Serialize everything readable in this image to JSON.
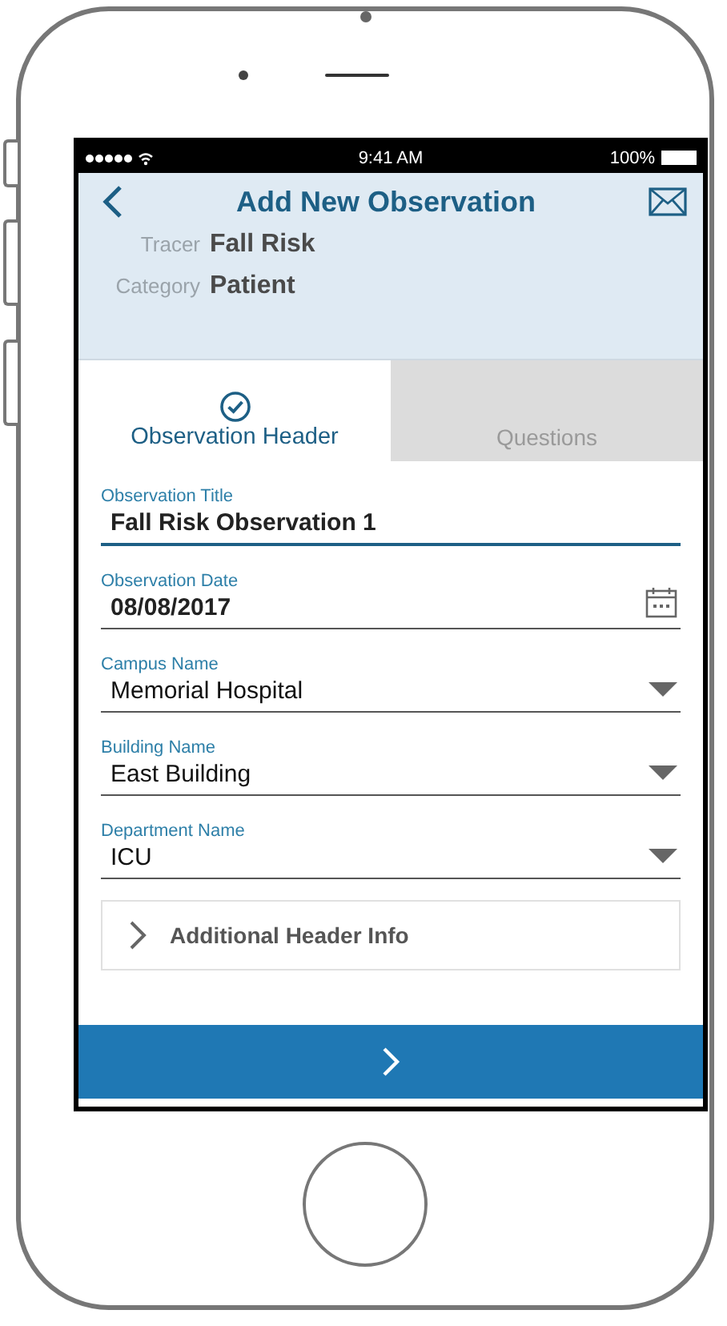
{
  "status_bar": {
    "time": "9:41 AM",
    "battery": "100%"
  },
  "header": {
    "title": "Add New Observation",
    "info": [
      {
        "label": "Tracer",
        "value": "Fall Risk"
      },
      {
        "label": "Category",
        "value": "Patient"
      }
    ]
  },
  "tabs": [
    {
      "label": "Observation Header",
      "selected": true,
      "completed": true
    },
    {
      "label": "Questions",
      "selected": false,
      "completed": false
    }
  ],
  "fields": [
    {
      "kind": "text",
      "label": "Observation Title",
      "value": "Fall Risk Observation 1",
      "focused": true
    },
    {
      "kind": "date",
      "label": "Observation Date",
      "value": "08/08/2017",
      "focused": false
    },
    {
      "kind": "dropdown",
      "label": "Campus Name",
      "value": "Memorial Hospital",
      "focused": false
    },
    {
      "kind": "dropdown",
      "label": "Building Name",
      "value": "East Building",
      "focused": false
    },
    {
      "kind": "dropdown",
      "label": "Department Name",
      "value": "ICU",
      "focused": false
    }
  ],
  "section": {
    "label": "Additional Header Info",
    "expanded": false
  }
}
